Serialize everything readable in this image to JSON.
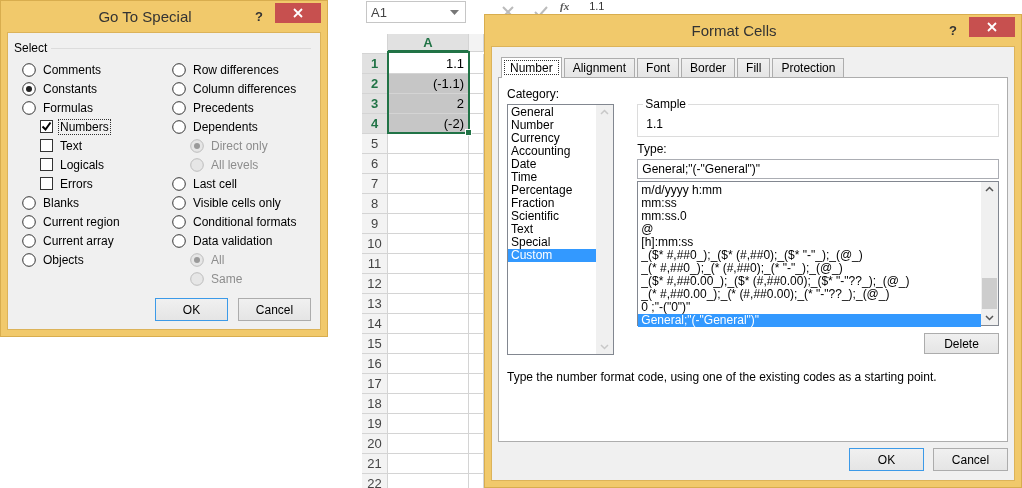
{
  "sheet": {
    "name_box": "A1",
    "function_label": "fx",
    "formula": "1.1",
    "column_header": {
      "label": "A",
      "selected": true
    },
    "rows": [
      {
        "number": "1",
        "value": "1.1",
        "selected": true
      },
      {
        "number": "2",
        "value": "(-1.1)",
        "selected": true
      },
      {
        "number": "3",
        "value": "2",
        "selected": true
      },
      {
        "number": "4",
        "value": "(-2)",
        "selected": true
      },
      {
        "number": "5",
        "selected": false
      },
      {
        "number": "6",
        "selected": false
      },
      {
        "number": "7",
        "selected": false
      },
      {
        "number": "8",
        "selected": false
      },
      {
        "number": "9",
        "selected": false
      },
      {
        "number": "10",
        "selected": false
      },
      {
        "number": "11",
        "selected": false
      },
      {
        "number": "12",
        "selected": false
      },
      {
        "number": "13",
        "selected": false
      },
      {
        "number": "14",
        "selected": false
      },
      {
        "number": "15",
        "selected": false
      },
      {
        "number": "16",
        "selected": false
      },
      {
        "number": "17",
        "selected": false
      },
      {
        "number": "18",
        "selected": false
      },
      {
        "number": "19",
        "selected": false
      },
      {
        "number": "20",
        "selected": false
      },
      {
        "number": "21",
        "selected": false
      },
      {
        "number": "22",
        "selected": false
      }
    ]
  },
  "go_to_special": {
    "title": "Go To Special",
    "help": "?",
    "group_label": "Select",
    "columns": [
      [
        {
          "kind": "radio",
          "label": "Comments",
          "selected": false,
          "disabled": false
        },
        {
          "kind": "radio",
          "label": "Constants",
          "selected": true,
          "disabled": false
        },
        {
          "kind": "radio",
          "label": "Formulas",
          "selected": false,
          "disabled": false,
          "children": [
            {
              "kind": "checkbox",
              "label": "Numbers",
              "checked": true,
              "focused": true
            },
            {
              "kind": "checkbox",
              "label": "Text",
              "checked": false,
              "focused": false
            },
            {
              "kind": "checkbox",
              "label": "Logicals",
              "checked": false,
              "focused": false
            },
            {
              "kind": "checkbox",
              "label": "Errors",
              "checked": false,
              "focused": false
            }
          ]
        },
        {
          "kind": "radio",
          "label": "Blanks",
          "selected": false,
          "disabled": false
        },
        {
          "kind": "radio",
          "label": "Current region",
          "selected": false,
          "disabled": false
        },
        {
          "kind": "radio",
          "label": "Current array",
          "selected": false,
          "disabled": false
        },
        {
          "kind": "radio",
          "label": "Objects",
          "selected": false,
          "disabled": false
        }
      ],
      [
        {
          "kind": "radio",
          "label": "Row differences",
          "selected": false,
          "disabled": false
        },
        {
          "kind": "radio",
          "label": "Column differences",
          "selected": false,
          "disabled": false
        },
        {
          "kind": "radio",
          "label": "Precedents",
          "selected": false,
          "disabled": false
        },
        {
          "kind": "radio",
          "label": "Dependents",
          "selected": false,
          "disabled": false,
          "children": [
            {
              "kind": "radio",
              "label": "Direct only",
              "selected": true,
              "disabled": true
            },
            {
              "kind": "radio",
              "label": "All levels",
              "selected": false,
              "disabled": true
            }
          ]
        },
        {
          "kind": "radio",
          "label": "Last cell",
          "selected": false,
          "disabled": false
        },
        {
          "kind": "radio",
          "label": "Visible cells only",
          "selected": false,
          "disabled": false
        },
        {
          "kind": "radio",
          "label": "Conditional formats",
          "selected": false,
          "disabled": false
        },
        {
          "kind": "radio",
          "label": "Data validation",
          "selected": false,
          "disabled": false,
          "children": [
            {
              "kind": "radio",
              "label": "All",
              "selected": true,
              "disabled": true
            },
            {
              "kind": "radio",
              "label": "Same",
              "selected": false,
              "disabled": true
            }
          ]
        }
      ]
    ],
    "buttons": [
      {
        "label": "OK",
        "default": true
      },
      {
        "label": "Cancel",
        "default": false
      }
    ]
  },
  "format_cells": {
    "title": "Format Cells",
    "help": "?",
    "tabs": [
      {
        "label": "Number",
        "selected": true
      },
      {
        "label": "Alignment",
        "selected": false
      },
      {
        "label": "Font",
        "selected": false
      },
      {
        "label": "Border",
        "selected": false
      },
      {
        "label": "Fill",
        "selected": false
      },
      {
        "label": "Protection",
        "selected": false
      }
    ],
    "category_label": "Category:",
    "categories": [
      {
        "label": "General",
        "selected": false
      },
      {
        "label": "Number",
        "selected": false
      },
      {
        "label": "Currency",
        "selected": false
      },
      {
        "label": "Accounting",
        "selected": false
      },
      {
        "label": "Date",
        "selected": false
      },
      {
        "label": "Time",
        "selected": false
      },
      {
        "label": "Percentage",
        "selected": false
      },
      {
        "label": "Fraction",
        "selected": false
      },
      {
        "label": "Scientific",
        "selected": false
      },
      {
        "label": "Text",
        "selected": false
      },
      {
        "label": "Special",
        "selected": false
      },
      {
        "label": "Custom",
        "selected": true
      }
    ],
    "sample_label": "Sample",
    "sample_value": "1.1",
    "type_label": "Type:",
    "type_value": "General;\"(-\"General\")\"",
    "formats": [
      {
        "label": "m/d/yyyy h:mm",
        "selected": false
      },
      {
        "label": "mm:ss",
        "selected": false
      },
      {
        "label": "mm:ss.0",
        "selected": false
      },
      {
        "label": "@",
        "selected": false
      },
      {
        "label": "[h]:mm:ss",
        "selected": false
      },
      {
        "label": "_($* #,##0_);_($* (#,##0);_($* \"-\"_);_(@_)",
        "selected": false
      },
      {
        "label": "_(* #,##0_);_(* (#,##0);_(* \"-\"_);_(@_)",
        "selected": false
      },
      {
        "label": "_($* #,##0.00_);_($* (#,##0.00);_($* \"-\"??_);_(@_)",
        "selected": false
      },
      {
        "label": "_(* #,##0.00_);_(* (#,##0.00);_(* \"-\"??_);_(@_)",
        "selected": false
      },
      {
        "label": "0 ;\"-(\"0\")\"",
        "selected": false
      },
      {
        "label": "General;\"(-\"General\")\"",
        "selected": true
      }
    ],
    "delete_button": "Delete",
    "hint": "Type the number format code, using one of the existing codes as a starting point.",
    "buttons": [
      {
        "label": "OK",
        "default": true
      },
      {
        "label": "Cancel",
        "default": false
      }
    ]
  }
}
